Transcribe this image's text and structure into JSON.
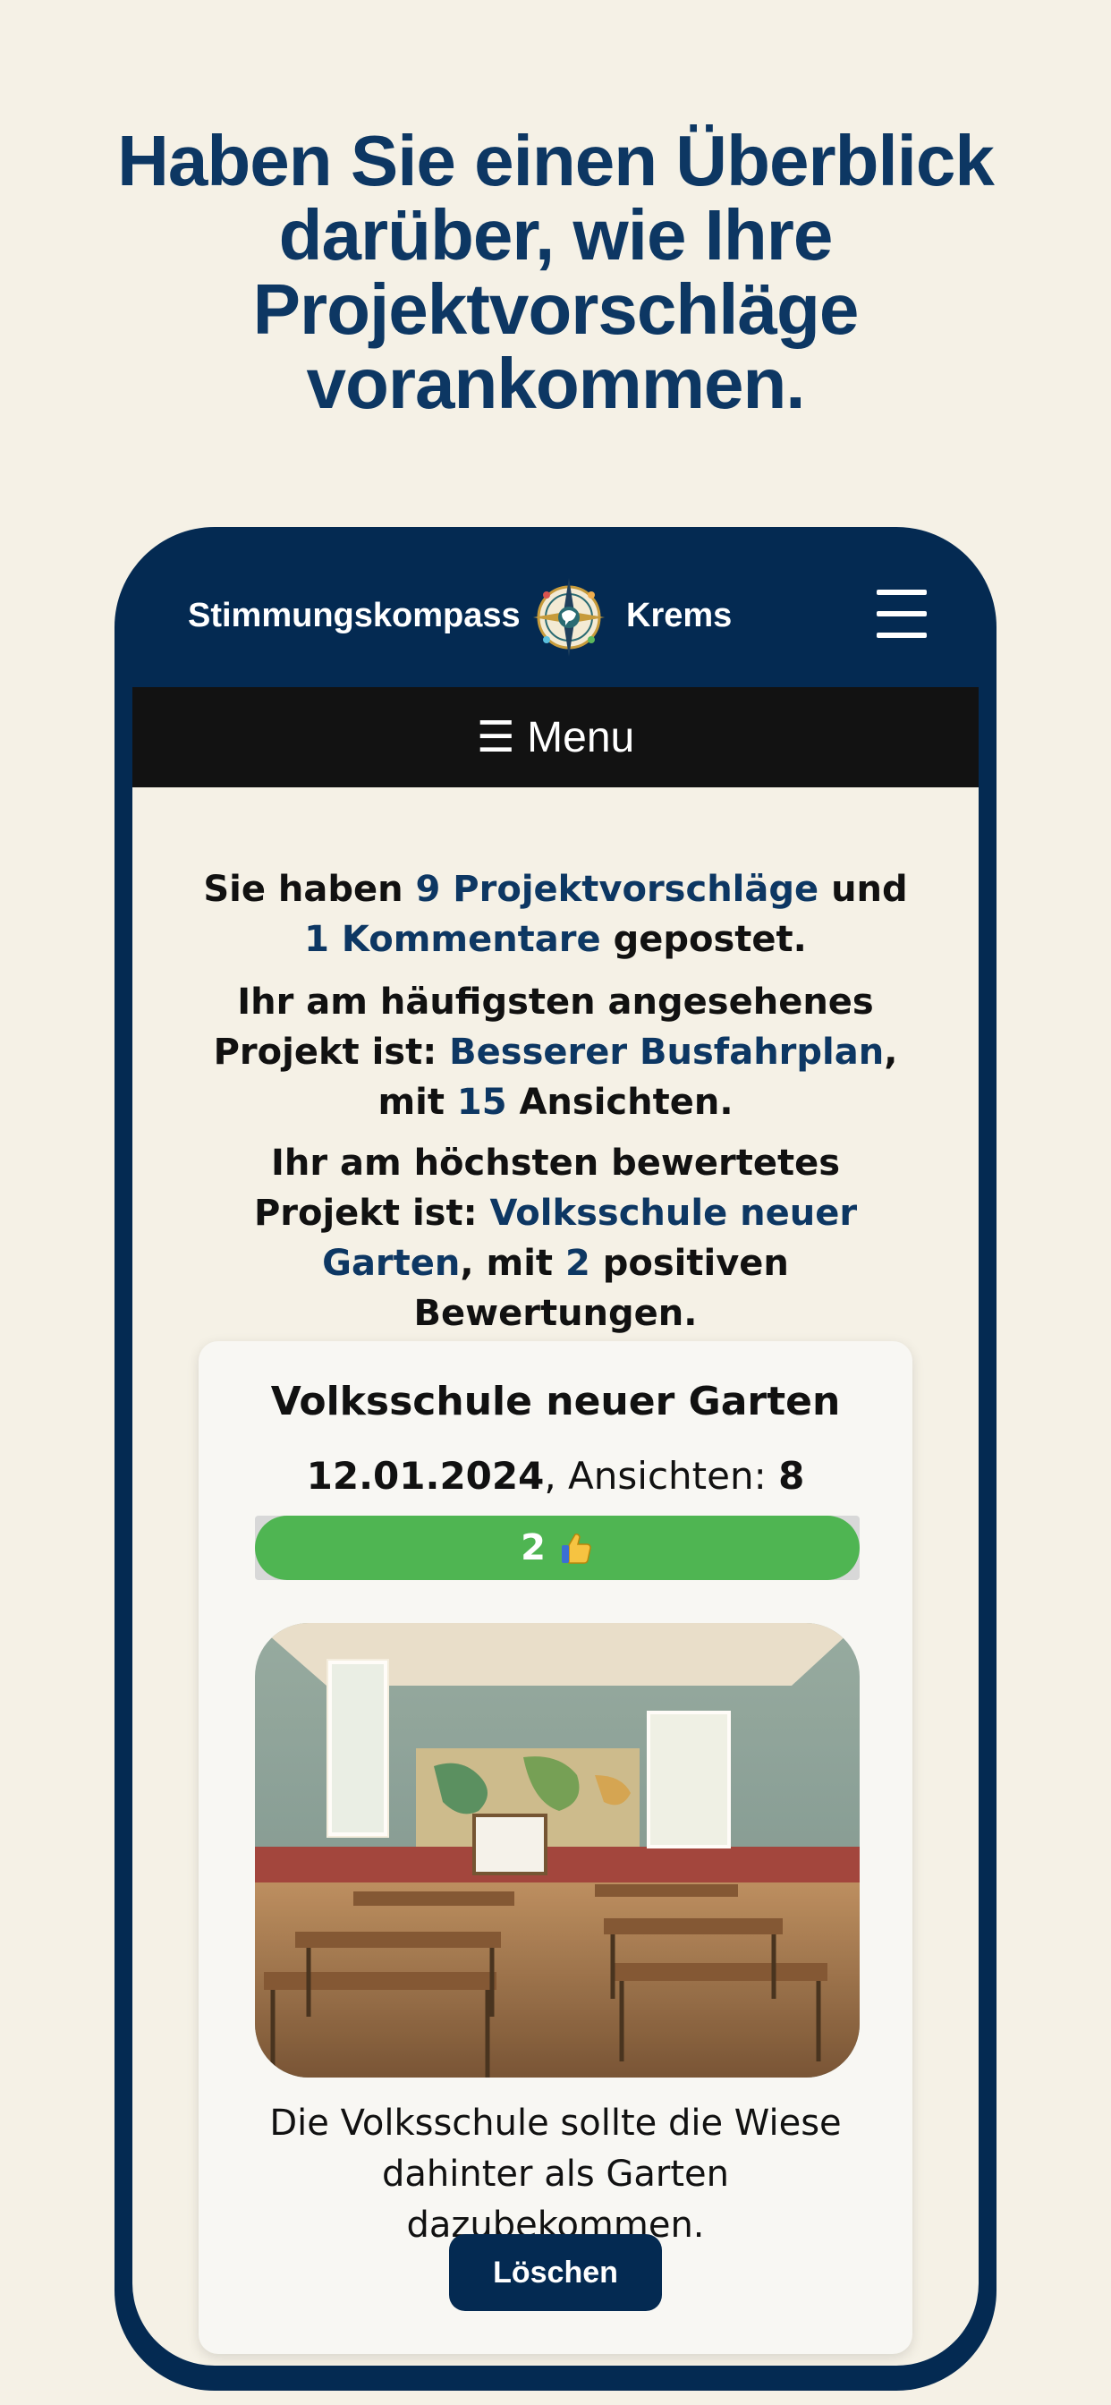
{
  "headline": "Haben Sie einen Überblick darüber, wie Ihre Projektvorschläge vorankommen.",
  "app": {
    "brand_left": "Stimmungskompass",
    "brand_right": "Krems",
    "logo_icon": "compass-logo-icon",
    "menu_icon": "hamburger-menu-icon",
    "menu_label": "☰ Menu"
  },
  "stats": {
    "line1_prefix": "Sie haben ",
    "proposals_link": "9 Projektvorschläge",
    "line1_and": " und ",
    "comments_link": "1 Kommentare",
    "line1_suffix": " gepostet.",
    "line2_prefix": "Ihr am häufigsten angesehenes Projekt ist: ",
    "most_viewed_link": "Besserer Busfahrplan",
    "line2_mid": ", mit ",
    "most_viewed_count": "15",
    "line2_suffix": " Ansichten.",
    "line3_prefix": "Ihr am höchsten bewertetes Projekt ist: ",
    "top_rated_link": "Volksschule neuer Garten",
    "line3_mid": ", mit ",
    "top_rated_count": "2",
    "line3_suffix": " positiven Bewertungen."
  },
  "project_card": {
    "title": "Volksschule neuer Garten",
    "date": "12.01.2024",
    "views_label": ", Ansichten: ",
    "views": "8",
    "votes_label": "2",
    "vote_fraction": 1.0,
    "vote_icon": "thumbs-up-icon",
    "description": "Die Volksschule sollte die Wiese dahinter als Garten dazubekommen.",
    "delete_label": "Löschen"
  },
  "colors": {
    "navy": "#042a52",
    "link": "#0d3763",
    "background": "#f5f1e6",
    "vote_green": "#4fb552",
    "menu_bar": "#121212"
  }
}
